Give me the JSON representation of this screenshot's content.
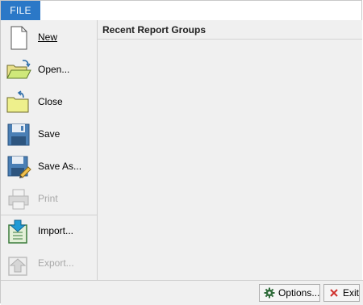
{
  "file_tab": {
    "label": "FILE"
  },
  "menu": {
    "items": [
      {
        "label": "New",
        "enabled": true,
        "icon": "new-document-icon"
      },
      {
        "label": "Open...",
        "enabled": true,
        "icon": "open-folder-icon"
      },
      {
        "label": "Close",
        "enabled": true,
        "icon": "close-folder-icon"
      },
      {
        "label": "Save",
        "enabled": true,
        "icon": "floppy-disk-icon"
      },
      {
        "label": "Save As...",
        "enabled": true,
        "icon": "save-as-icon"
      },
      {
        "label": "Print",
        "enabled": false,
        "icon": "printer-icon"
      },
      {
        "label": "Import...",
        "enabled": true,
        "icon": "import-icon"
      },
      {
        "label": "Export...",
        "enabled": false,
        "icon": "export-icon"
      }
    ]
  },
  "panel": {
    "title": "Recent Report Groups"
  },
  "buttons": {
    "options": {
      "label": "Options...",
      "icon": "gear-icon"
    },
    "exit": {
      "label": "Exit",
      "icon": "close-x-icon"
    }
  },
  "colors": {
    "accent": "#2b78c7",
    "exit_red": "#d0312d",
    "gear_green": "#2f6b3a"
  }
}
